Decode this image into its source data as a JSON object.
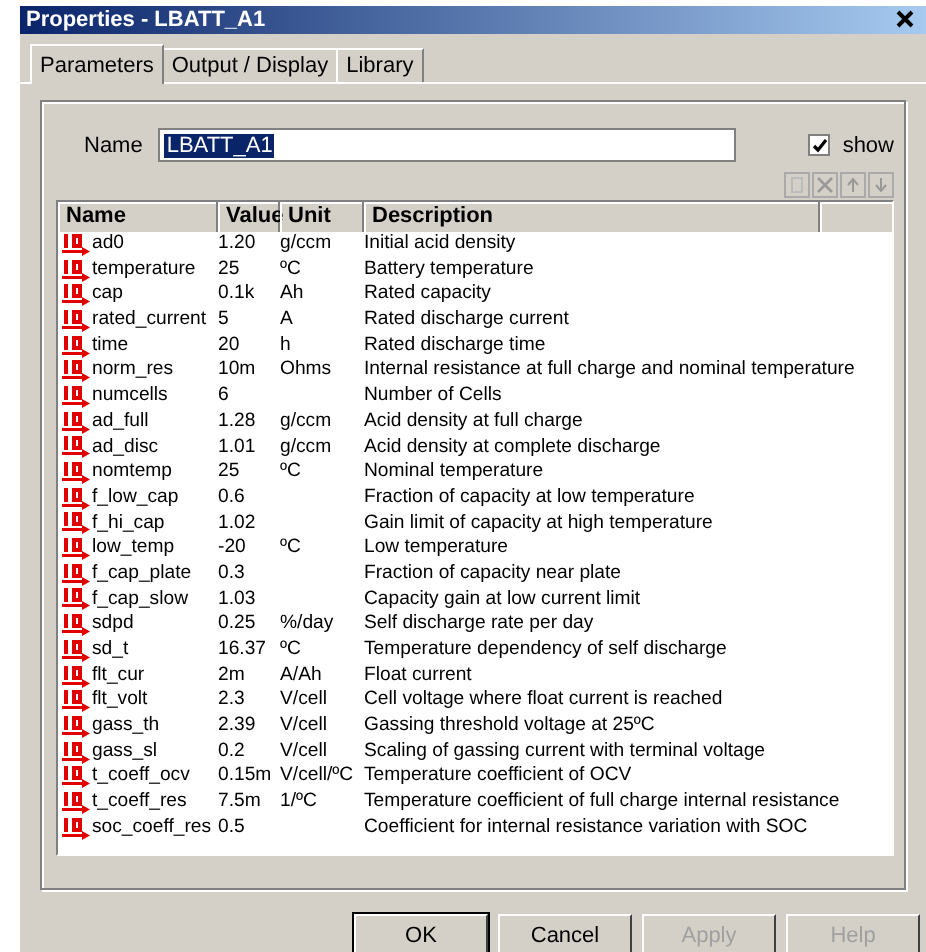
{
  "window": {
    "title": "Properties - LBATT_A1"
  },
  "tabs": [
    {
      "label": "Parameters",
      "selected": true
    },
    {
      "label": "Output / Display",
      "selected": false
    },
    {
      "label": "Library",
      "selected": false
    }
  ],
  "name_field": {
    "label": "Name",
    "value": "LBATT_A1"
  },
  "show_checkbox": {
    "label": "show",
    "checked": true
  },
  "table": {
    "columns": [
      "Name",
      "Value",
      "Unit",
      "Description"
    ],
    "rows": [
      {
        "name": "ad0",
        "value": "1.20",
        "unit": "g/ccm",
        "description": "Initial acid density"
      },
      {
        "name": "temperature",
        "value": "25",
        "unit": "ºC",
        "description": "Battery temperature"
      },
      {
        "name": "cap",
        "value": "0.1k",
        "unit": "Ah",
        "description": "Rated capacity"
      },
      {
        "name": "rated_current",
        "value": "5",
        "unit": "A",
        "description": "Rated discharge current"
      },
      {
        "name": "time",
        "value": "20",
        "unit": "h",
        "description": "Rated discharge time"
      },
      {
        "name": "norm_res",
        "value": "10m",
        "unit": "Ohms",
        "description": "Internal resistance at full charge and nominal temperature"
      },
      {
        "name": "numcells",
        "value": "6",
        "unit": "",
        "description": "Number of Cells"
      },
      {
        "name": "ad_full",
        "value": "1.28",
        "unit": "g/ccm",
        "description": "Acid density at full charge"
      },
      {
        "name": "ad_disc",
        "value": "1.01",
        "unit": "g/ccm",
        "description": "Acid density at complete discharge"
      },
      {
        "name": "nomtemp",
        "value": "25",
        "unit": "ºC",
        "description": "Nominal temperature"
      },
      {
        "name": "f_low_cap",
        "value": "0.6",
        "unit": "",
        "description": "Fraction of capacity at low temperature"
      },
      {
        "name": "f_hi_cap",
        "value": "1.02",
        "unit": "",
        "description": "Gain limit of capacity at high temperature"
      },
      {
        "name": "low_temp",
        "value": "-20",
        "unit": "ºC",
        "description": "Low temperature"
      },
      {
        "name": "f_cap_plate",
        "value": "0.3",
        "unit": "",
        "description": "Fraction of capacity near plate"
      },
      {
        "name": "f_cap_slow",
        "value": "1.03",
        "unit": "",
        "description": "Capacity gain at low current limit"
      },
      {
        "name": "sdpd",
        "value": "0.25",
        "unit": "%/day",
        "description": "Self discharge rate per day"
      },
      {
        "name": "sd_t",
        "value": "16.37",
        "unit": "ºC",
        "description": "Temperature dependency of self discharge"
      },
      {
        "name": "flt_cur",
        "value": "2m",
        "unit": "A/Ah",
        "description": "Float current"
      },
      {
        "name": "flt_volt",
        "value": "2.3",
        "unit": "V/cell",
        "description": "Cell voltage where float current is reached"
      },
      {
        "name": "gass_th",
        "value": "2.39",
        "unit": "V/cell",
        "description": "Gassing threshold voltage at 25ºC"
      },
      {
        "name": "gass_sl",
        "value": "0.2",
        "unit": "V/cell",
        "description": "Scaling of gassing current with terminal voltage"
      },
      {
        "name": "t_coeff_ocv",
        "value": "0.15m",
        "unit": "V/cell/ºC",
        "description": "Temperature coefficient of OCV"
      },
      {
        "name": "t_coeff_res",
        "value": "7.5m",
        "unit": "1/ºC",
        "description": "Temperature coefficient of full charge internal resistance"
      },
      {
        "name": "soc_coeff_res",
        "value": "0.5",
        "unit": "",
        "description": "Coefficient for internal resistance variation with SOC"
      }
    ]
  },
  "buttons": [
    {
      "label": "OK",
      "disabled": false
    },
    {
      "label": "Cancel",
      "disabled": false
    },
    {
      "label": "Apply",
      "disabled": true
    },
    {
      "label": "Help",
      "disabled": true
    }
  ]
}
